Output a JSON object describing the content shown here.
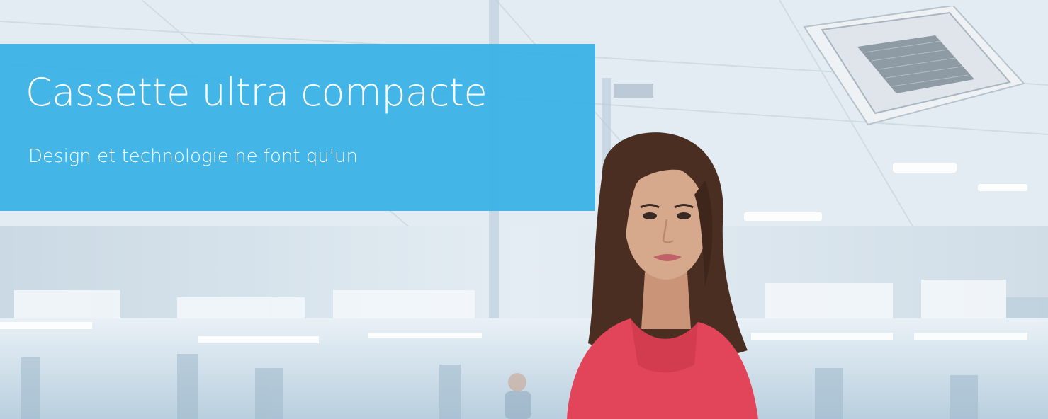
{
  "banner": {
    "title": "Cassette ultra compacte",
    "subtitle": "Design et technologie ne font qu'un",
    "color": "#38b0e6"
  },
  "scene": {
    "background_color": "#dce7ef",
    "shirt_color": "#e2455a",
    "hair_color": "#4a2e22",
    "skin_color": "#d7a98c"
  }
}
